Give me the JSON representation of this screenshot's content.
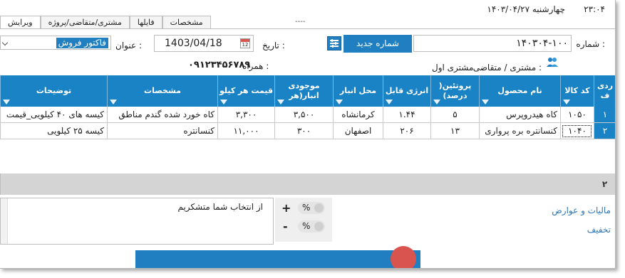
{
  "top": {
    "time": "۲۳:۰۴",
    "date": "چهارشنبه ۱۴۰۳/۰۴/۲۷",
    "placeholder_dash": "----"
  },
  "tabs": [
    {
      "label": "ویرایش",
      "active": true
    },
    {
      "label": "مشتری/متقاضی/پروژه",
      "active": false
    },
    {
      "label": "فایلها",
      "active": false
    },
    {
      "label": "مشخصات",
      "active": false
    }
  ],
  "form": {
    "number_label": "شماره :",
    "number_value": "۱۴۰۳۰۴-۱۰۰",
    "new_number_button": "شماره جدید",
    "date_label": "تاریخ :",
    "date_value": "1403/04/18",
    "calendar_num": "12",
    "title_label": "عنوان :",
    "title_value": "فاکتور فروش",
    "customer_label": "مشتری / متقاضی :",
    "customer_value": "مشتری اول",
    "mobile_label": "همراه :",
    "mobile_value": "۰۹۱۲۳۴۵۶۷۸۹"
  },
  "table": {
    "columns": [
      {
        "key": "row",
        "label": "ردی ف"
      },
      {
        "key": "code",
        "label": "کد کالا"
      },
      {
        "key": "name",
        "label": "نام محصول"
      },
      {
        "key": "protein",
        "label": "پروتئین( درصد)"
      },
      {
        "key": "energy",
        "label": "انرژی قابل"
      },
      {
        "key": "place",
        "label": "محل انبار"
      },
      {
        "key": "stock",
        "label": "موجودی انبار(هر"
      },
      {
        "key": "price",
        "label": "قیمت هر کیلو"
      },
      {
        "key": "spec",
        "label": "مشخصات"
      },
      {
        "key": "desc",
        "label": "توضیحات"
      }
    ],
    "rows": [
      {
        "row": "۱",
        "code": "۱۰۵۰",
        "name": "کاه هیدروپرس",
        "protein": "۵",
        "energy": "۱.۴۴",
        "place": "کرمانشاه",
        "stock": "۳,۵۰۰",
        "price": "۳,۳۰۰",
        "spec": "کاه خورد شده گندم مناطق",
        "desc": "کیسه های ۴۰ کیلویی_قیمت"
      },
      {
        "row": "۲",
        "code": "۱۰۴۰",
        "name": "کنسانتره بره پرواری",
        "protein": "۱۳",
        "energy": "۲۰۶",
        "place": "اصفهان",
        "stock": "۳۰۰",
        "price": "۱۱,۰۰۰",
        "spec": "کنسانتره",
        "desc": "کیسه ۲۵ کیلویی"
      }
    ],
    "footer_count": "۲"
  },
  "summary": {
    "taxes_label": "مالیات و عوارض",
    "discount_label": "تخفیف",
    "plus_label": "+",
    "minus_label": "-",
    "percent_label": "%",
    "notes_text": "از انتخاب شما متشکریم"
  },
  "colors": {
    "accent": "#1a83c5",
    "button": "#1f7fc0",
    "link": "#2e75b6"
  }
}
